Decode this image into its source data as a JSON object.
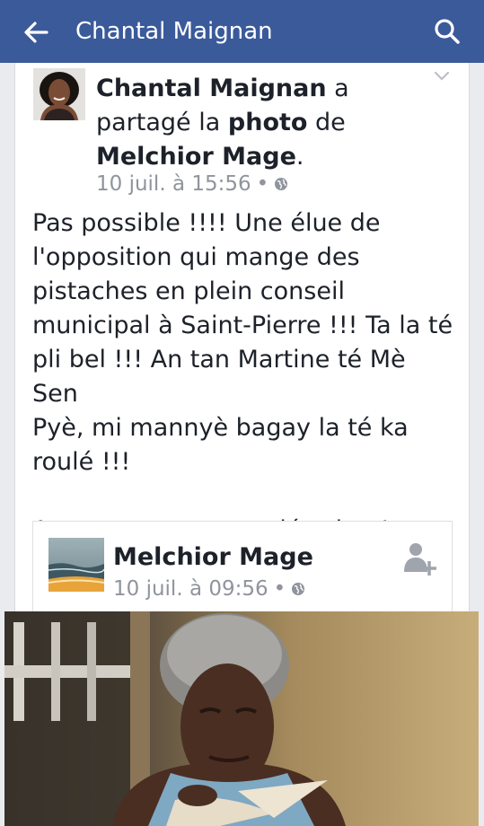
{
  "topbar": {
    "title": "Chantal Maignan",
    "back_icon": "back-arrow-icon",
    "search_icon": "search-icon",
    "color": "#3b5a9a"
  },
  "post": {
    "author": "Chantal Maignan",
    "action_a": " a",
    "action_shared": "partagé la ",
    "action_photo": "photo",
    "action_of": " de",
    "original_author": "Melchior Mage",
    "period": ".",
    "timestamp": "10 juil. à 15:56",
    "dot": "•",
    "privacy_icon": "globe-icon",
    "menu_icon": "chevron-down-icon",
    "body": "Pas possible !!!! Une élue de\nl'opposition qui mange des\npistaches en plein conseil\nmunicipal  à Saint-Pierre !!! Ta la té\npli bel !!! An tan Martine té Mè Sen\nPyè, mi mannyè bagay la té ka\nroulé !!!\n\nA partager sans modération !"
  },
  "shared": {
    "author": "Melchior Mage",
    "timestamp": "10 juil. à 09:56",
    "dot": "•",
    "privacy_icon": "globe-icon",
    "add_friend_icon": "add-friend-icon"
  },
  "colors": {
    "meta_text": "#90949c",
    "body_text": "#1d2129"
  }
}
